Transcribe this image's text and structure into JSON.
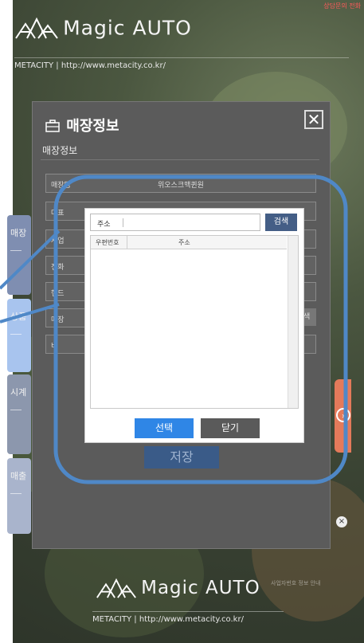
{
  "app": {
    "brand_name": "Magic AUTO",
    "brand_sub": "METACITY  |  http://www.metacity.co.kr/",
    "corner_tag": "상담문의 전화",
    "faint_note": "사업자번호 정보 안내",
    "accent": "#e47a5a",
    "brand_blue": "#445e86"
  },
  "side_tabs": [
    {
      "label": "매장",
      "color": "#7f8eb1"
    },
    {
      "label": "상품",
      "color": "#a8c4ee"
    },
    {
      "label": "시계",
      "color": "#8c97ad"
    },
    {
      "label": "매출",
      "color": "#a9b4cc"
    }
  ],
  "dialog": {
    "title": "매장정보",
    "close": "✕",
    "subtab": "매장정보",
    "rows": [
      {
        "label": "매장명",
        "value": "위오스크맥퀸원"
      },
      {
        "label": "대표",
        "value": ""
      },
      {
        "label": "사업",
        "value": ""
      },
      {
        "label": "전화",
        "value": ""
      },
      {
        "label": "핸드",
        "value": ""
      },
      {
        "label": "매장",
        "value": ""
      },
      {
        "label": "비",
        "value": ""
      }
    ],
    "search_label": "검색",
    "save_label": "저장"
  },
  "popup": {
    "field_label": "주소",
    "field_value": "",
    "search_label": "검색",
    "columns": [
      "우편번호",
      "주소"
    ],
    "select_label": "선택",
    "close_label": "닫기"
  }
}
